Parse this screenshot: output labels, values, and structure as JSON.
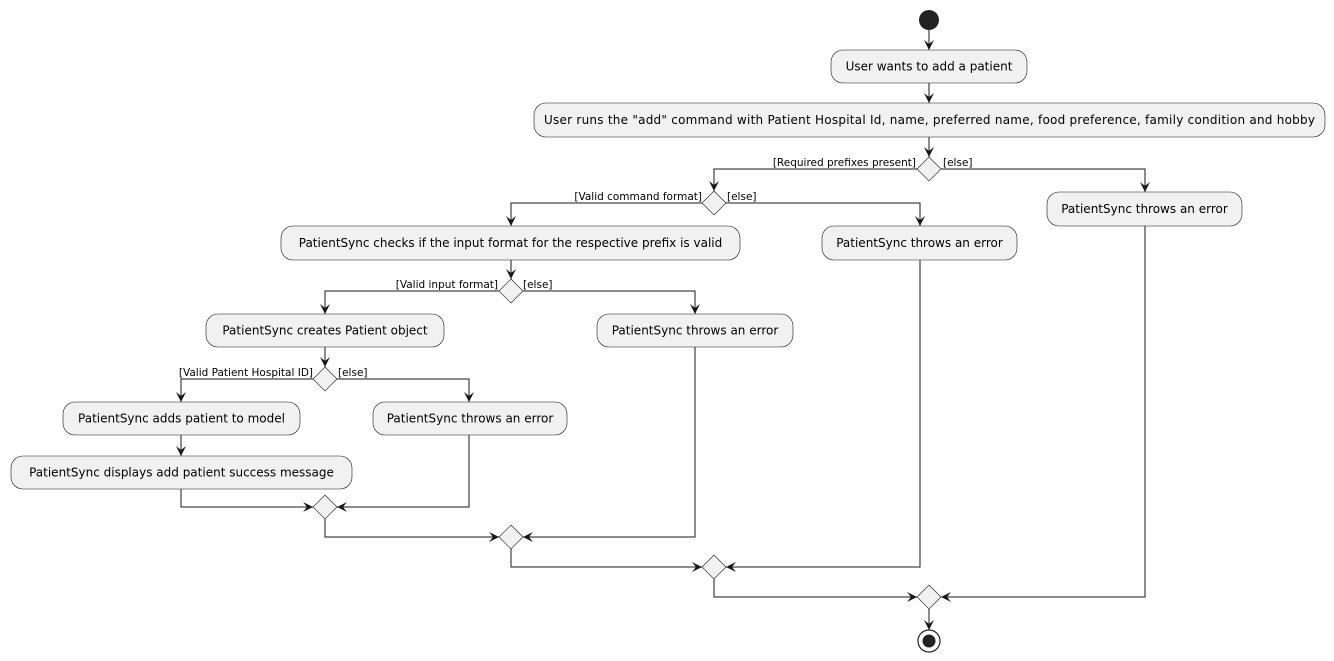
{
  "diagram": {
    "type": "activity",
    "colors": {
      "node_fill": "#F1F1F1",
      "line": "#181818",
      "start_end": "#222222"
    },
    "activities": {
      "want_add": "User wants to add a patient",
      "runs_add": "User runs the \"add\" command with Patient Hospital Id, name, preferred name, food preference, family condition and hobby",
      "error_prefixes": "PatientSync throws an error",
      "error_command": "PatientSync throws an error",
      "checks_input": "PatientSync checks if the input format for the respective prefix is valid",
      "error_input": "PatientSync throws an error",
      "creates_patient": "PatientSync creates Patient object",
      "error_id": "PatientSync throws an error",
      "adds_patient": "PatientSync adds patient to model",
      "displays_success": "PatientSync displays add patient success message"
    },
    "guards": {
      "prefixes_yes": "[Required prefixes present]",
      "prefixes_no": "[else]",
      "command_yes": "[Valid command format]",
      "command_no": "[else]",
      "input_yes": "[Valid input format]",
      "input_no": "[else]",
      "id_yes": "[Valid Patient Hospital ID]",
      "id_no": "[else]"
    }
  }
}
